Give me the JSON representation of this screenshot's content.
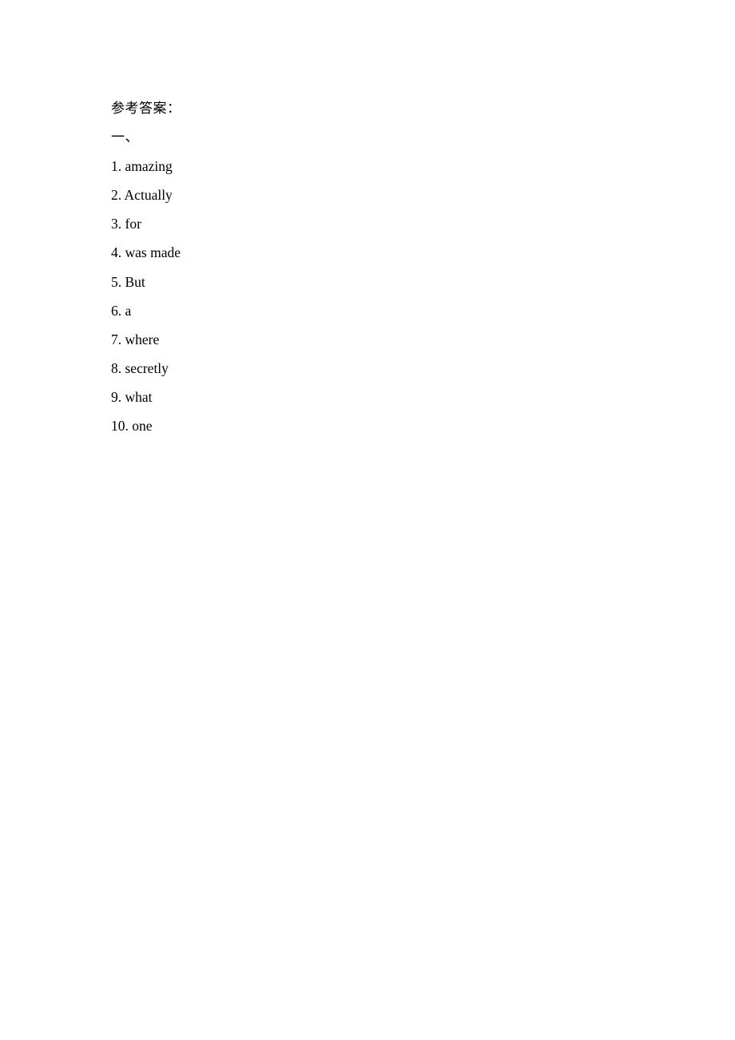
{
  "document": {
    "title": "参考答案：",
    "section": "一、",
    "answers": [
      {
        "number": "1.",
        "text": "amazing"
      },
      {
        "number": "2.",
        "text": "Actually"
      },
      {
        "number": "3.",
        "text": "for"
      },
      {
        "number": "4.",
        "text": "was made"
      },
      {
        "number": "5.",
        "text": "But"
      },
      {
        "number": "6.",
        "text": "a"
      },
      {
        "number": "7.",
        "text": "where"
      },
      {
        "number": "8.",
        "text": "secretly"
      },
      {
        "number": "9.",
        "text": "what"
      },
      {
        "number": "10.",
        "text": "one"
      }
    ]
  }
}
